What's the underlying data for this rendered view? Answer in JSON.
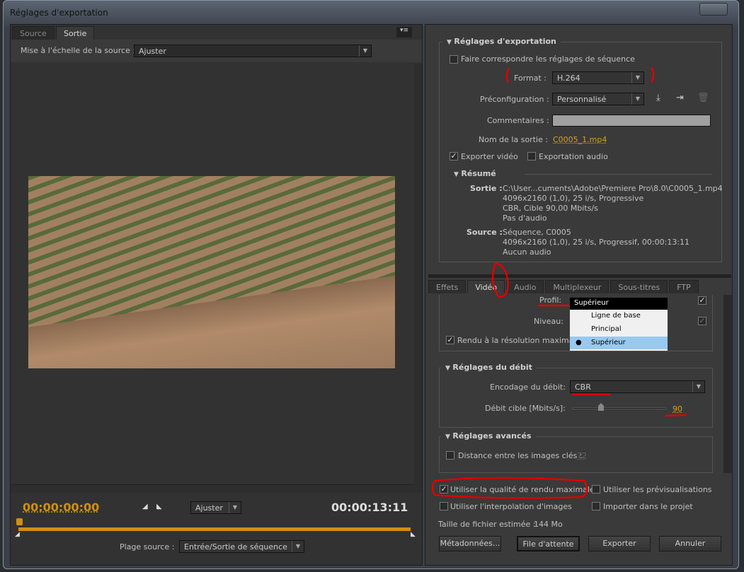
{
  "window": {
    "title": "Réglages d'exportation"
  },
  "left": {
    "tabs": [
      {
        "label": "Source",
        "active": false
      },
      {
        "label": "Sortie",
        "active": true
      }
    ],
    "scale_label": "Mise à l'échelle de la source :",
    "scale_value": "Ajuster",
    "timecode_current": "00:00:00:00",
    "timecode_duration": "00:00:13:11",
    "zoom_value": "Ajuster",
    "range_label": "Plage source :",
    "range_value": "Entrée/Sortie de séquence",
    "accent_color": "#d09010"
  },
  "export_settings": {
    "header": "Réglages d'exportation",
    "match_sequence": {
      "label": "Faire correspondre les réglages de séquence",
      "checked": false
    },
    "format_label": "Format :",
    "format_value": "H.264",
    "preset_label": "Préconfiguration :",
    "preset_value": "Personnalisé",
    "comments_label": "Commentaires :",
    "comments_value": "",
    "output_name_label": "Nom de la sortie :",
    "output_name_value": "C0005_1.mp4",
    "export_video": {
      "label": "Exporter vidéo",
      "checked": true
    },
    "export_audio": {
      "label": "Exportation audio",
      "checked": false
    },
    "summary": {
      "header": "Résumé",
      "output_label": "Sortie :",
      "output_lines": [
        "C:\\User...cuments\\Adobe\\Premiere Pro\\8.0\\C0005_1.mp4",
        "4096x2160 (1,0), 25 i/s, Progressive",
        "CBR, Cible 90,00  Mbits/s",
        "Pas d'audio"
      ],
      "source_label": "Source :",
      "source_lines": [
        "Séquence, C0005",
        "4096x2160 (1,0), 25  i/s, Progressif, 00:00:13:11",
        "Aucun audio"
      ]
    }
  },
  "settings_tabs": [
    {
      "label": "Effets"
    },
    {
      "label": "Vidéo",
      "active": true
    },
    {
      "label": "Audio"
    },
    {
      "label": "Multiplexeur"
    },
    {
      "label": "Sous-titres"
    },
    {
      "label": "FTP"
    }
  ],
  "video": {
    "profile_label": "Profil:",
    "level_label": "Niveau:",
    "max_depth": {
      "label": "Rendu à la résolution maximale",
      "checked": true
    },
    "profile_dropdown": {
      "current": "Supérieur",
      "options": [
        "Ligne de base",
        "Principal",
        "Supérieur"
      ],
      "selected": "Supérieur"
    },
    "bitrate": {
      "header": "Réglages du débit",
      "encoding_label": "Encodage du débit:",
      "encoding_value": "CBR",
      "target_label": "Débit cible [Mbits/s]:",
      "target_value": "90",
      "slider_fraction": 0.3
    },
    "advanced": {
      "header": "Réglages avancés",
      "keyframe": {
        "label": "Distance entre les images clés :",
        "checked": false,
        "value": "72"
      }
    }
  },
  "bottom": {
    "max_quality": {
      "label": "Utiliser la qualité de rendu maximale",
      "checked": true
    },
    "use_previews": {
      "label": "Utiliser les prévisualisations",
      "checked": false
    },
    "frame_blending": {
      "label": "Utiliser l'interpolation d'images",
      "checked": false
    },
    "import_project": {
      "label": "Importer dans le projet",
      "checked": false
    },
    "filesize_label": "Taille de fichier estimée :",
    "filesize_value": "144 Mo",
    "buttons": {
      "metadata": "Métadonnées...",
      "queue": "File d'attente",
      "export": "Exporter",
      "cancel": "Annuler"
    }
  }
}
